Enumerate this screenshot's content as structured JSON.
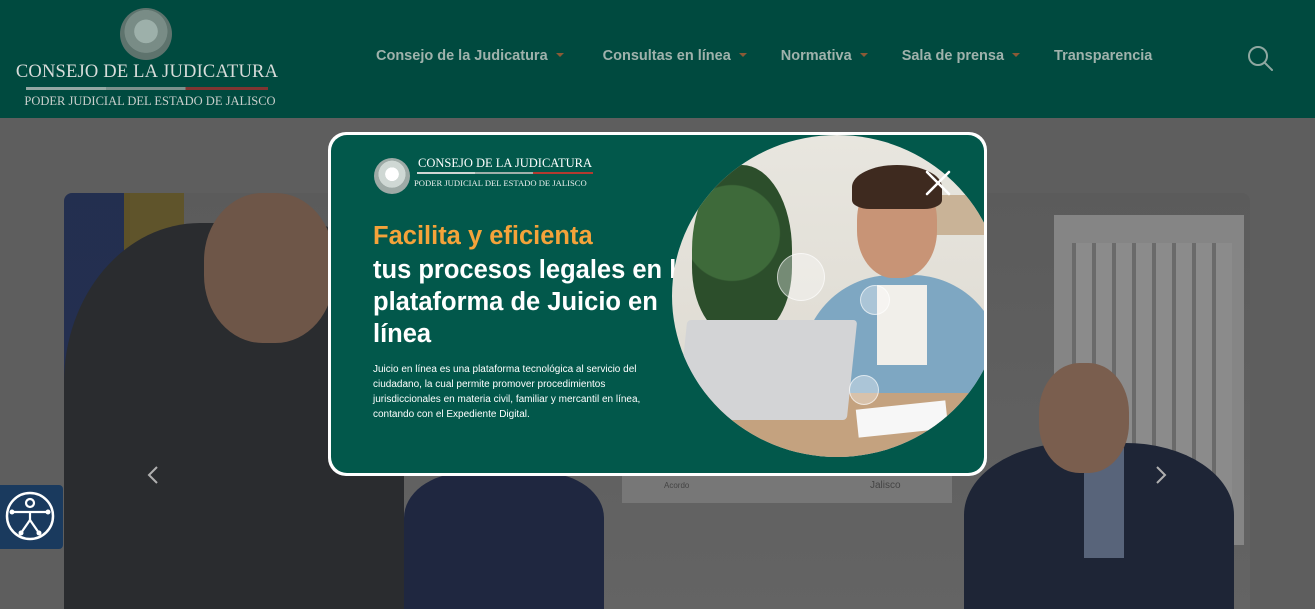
{
  "header": {
    "logo_title": "CONSEJO DE LA JUDICATURA",
    "logo_subtitle": "PODER JUDICIAL DEL ESTADO DE JALISCO",
    "nav": [
      {
        "label": "Consejo de la Judicatura",
        "has_dropdown": true
      },
      {
        "label": "Consultas en línea",
        "has_dropdown": true
      },
      {
        "label": "Normativa",
        "has_dropdown": true
      },
      {
        "label": "Sala de prensa",
        "has_dropdown": true
      },
      {
        "label": "Transparencia",
        "has_dropdown": false
      }
    ],
    "search_icon": "search-icon"
  },
  "hero": {
    "sign_left": "Acordo",
    "sign_right": "Jalisco",
    "prev_icon": "chevron-left-icon",
    "next_icon": "chevron-right-icon"
  },
  "accessibility": {
    "icon": "accessibility-icon"
  },
  "modal": {
    "logo_title": "CONSEJO DE LA JUDICATURA",
    "logo_subtitle": "PODER JUDICIAL DEL ESTADO DE JALISCO",
    "headline_highlight": "Facilita y eficienta",
    "headline_rest": "tus procesos legales en la plataforma de Juicio en línea",
    "body": "Juicio en línea es una plataforma tecnológica al servicio del ciudadano, la cual permite promover procedimientos jurisdiccionales en materia civil, familiar y mercantil en línea, contando con el Expediente Digital.",
    "close_icon": "close-icon"
  },
  "colors": {
    "header_bg": "#004a3f",
    "modal_bg": "#02584b",
    "highlight": "#f4a33a",
    "accessibility_bg": "#1a3a5e"
  }
}
